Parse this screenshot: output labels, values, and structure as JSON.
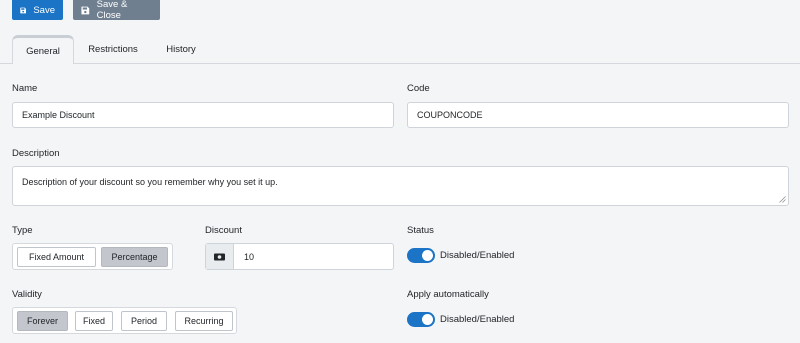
{
  "toolbar": {
    "save_label": "Save",
    "save_close_label": "Save & Close"
  },
  "tabs": [
    {
      "label": "General",
      "active": true
    },
    {
      "label": "Restrictions",
      "active": false
    },
    {
      "label": "History",
      "active": false
    }
  ],
  "form": {
    "name": {
      "label": "Name",
      "value": "Example Discount"
    },
    "code": {
      "label": "Code",
      "value": "COUPONCODE"
    },
    "description": {
      "label": "Description",
      "value": "Description of your discount so you remember why you set it up."
    },
    "type": {
      "label": "Type",
      "options": [
        "Fixed Amount",
        "Percentage"
      ],
      "selected": "Percentage"
    },
    "discount": {
      "label": "Discount",
      "value": "10",
      "icon": "money-icon"
    },
    "status": {
      "label": "Status",
      "toggle_label": "Disabled/Enabled",
      "enabled": true
    },
    "validity": {
      "label": "Validity",
      "options": [
        "Forever",
        "Fixed",
        "Period",
        "Recurring"
      ],
      "selected": "Forever"
    },
    "apply_auto": {
      "label": "Apply automatically",
      "toggle_label": "Disabled/Enabled",
      "enabled": true
    }
  },
  "colors": {
    "primary": "#1b74c5",
    "secondary": "#6f7f90",
    "selected_option": "#c3c7cd",
    "background": "#f4f5f7"
  }
}
